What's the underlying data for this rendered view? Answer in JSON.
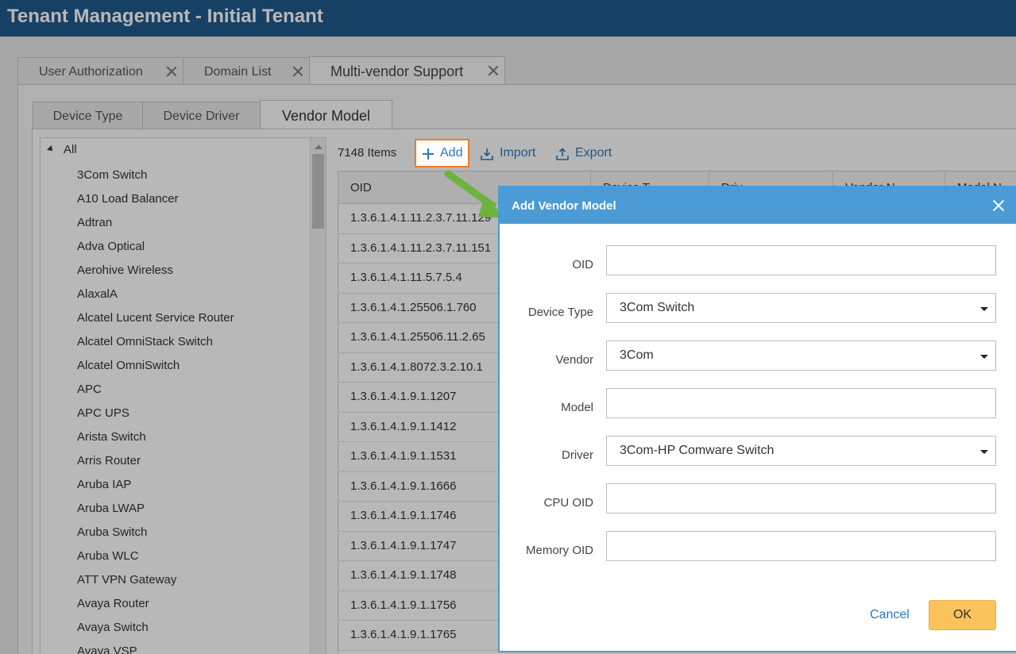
{
  "app": {
    "title": "Tenant Management - Initial Tenant"
  },
  "outer_tabs": [
    {
      "label": "User Authorization"
    },
    {
      "label": "Domain List"
    },
    {
      "label": "Multi-vendor Support"
    }
  ],
  "inner_tabs": [
    {
      "label": "Device Type"
    },
    {
      "label": "Device Driver"
    },
    {
      "label": "Vendor Model"
    }
  ],
  "tree": {
    "root": "All",
    "items": [
      "3Com Switch",
      "A10 Load Balancer",
      "Adtran",
      "Adva Optical",
      "Aerohive Wireless",
      "AlaxalA",
      "Alcatel Lucent Service Router",
      "Alcatel OmniStack Switch",
      "Alcatel OmniSwitch",
      "APC",
      "APC UPS",
      "Arista Switch",
      "Arris Router",
      "Aruba IAP",
      "Aruba LWAP",
      "Aruba Switch",
      "Aruba WLC",
      "ATT VPN Gateway",
      "Avaya Router",
      "Avaya Switch",
      "Avaya VSP"
    ]
  },
  "toolbar": {
    "count": "7148 Items",
    "add": "Add",
    "import": "Import",
    "export": "Export"
  },
  "grid": {
    "columns": [
      "OID",
      "Device T",
      "Driv",
      "Vendor N",
      "Model N"
    ],
    "rows": [
      "1.3.6.1.4.1.11.2.3.7.11.129",
      "1.3.6.1.4.1.11.2.3.7.11.151",
      "1.3.6.1.4.1.11.5.7.5.4",
      "1.3.6.1.4.1.25506.1.760",
      "1.3.6.1.4.1.25506.11.2.65",
      "1.3.6.1.4.1.8072.3.2.10.1",
      "1.3.6.1.4.1.9.1.1207",
      "1.3.6.1.4.1.9.1.1412",
      "1.3.6.1.4.1.9.1.1531",
      "1.3.6.1.4.1.9.1.1666",
      "1.3.6.1.4.1.9.1.1746",
      "1.3.6.1.4.1.9.1.1747",
      "1.3.6.1.4.1.9.1.1748",
      "1.3.6.1.4.1.9.1.1756",
      "1.3.6.1.4.1.9.1.1765"
    ]
  },
  "dialog": {
    "title": "Add Vendor Model",
    "fields": {
      "oid": {
        "label": "OID",
        "value": ""
      },
      "device_type": {
        "label": "Device Type",
        "value": "3Com Switch"
      },
      "vendor": {
        "label": "Vendor",
        "value": "3Com"
      },
      "model": {
        "label": "Model",
        "value": ""
      },
      "driver": {
        "label": "Driver",
        "value": "3Com-HP Comware Switch"
      },
      "cpu_oid": {
        "label": "CPU OID",
        "value": ""
      },
      "memory_oid": {
        "label": "Memory OID",
        "value": ""
      }
    },
    "cancel": "Cancel",
    "ok": "OK"
  },
  "colors": {
    "titlebar": "#21598c",
    "dialog_header": "#4a9bd6",
    "accent_link": "#2c7ab8",
    "highlight_border": "#ee7d24",
    "ok_button": "#fcc35d",
    "arrow": "#6db33f"
  }
}
